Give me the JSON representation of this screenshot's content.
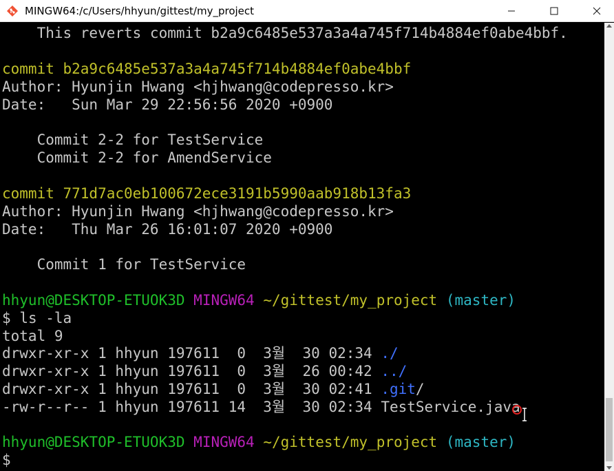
{
  "window": {
    "title": "MINGW64:/c/Users/hhyun/gittest/my_project",
    "minimize_label": "—",
    "maximize_label": "☐",
    "close_label": "✕",
    "app_icon": "git-bash-icon"
  },
  "colors": {
    "commit_hash": "#c1c12a",
    "prompt_user": "#1fbf2a",
    "prompt_shell": "#b820b8",
    "prompt_path": "#c1c12a",
    "prompt_branch": "#2eb7c4",
    "directory": "#4070ff",
    "text": "#c8c8c8",
    "background": "#000000"
  },
  "log": {
    "revert_message": "    This reverts commit b2a9c6485e537a3a4a745f714b4884ef0abe4bbf.",
    "commits": [
      {
        "commit_line": "commit b2a9c6485e537a3a4a745f714b4884ef0abe4bbf",
        "author_line": "Author: Hyunjin Hwang <hjhwang@codepresso.kr>",
        "date_line": "Date:   Sun Mar 29 22:56:56 2020 +0900",
        "messages": [
          "    Commit 2-2 for TestService",
          "    Commit 2-2 for AmendService"
        ]
      },
      {
        "commit_line": "commit 771d7ac0eb100672ece3191b5990aab918b13fa3",
        "author_line": "Author: Hyunjin Hwang <hjhwang@codepresso.kr>",
        "date_line": "Date:   Thu Mar 26 16:01:07 2020 +0900",
        "messages": [
          "    Commit 1 for TestService"
        ]
      }
    ]
  },
  "prompt": {
    "user_host": "hhyun@DESKTOP-ETUOK3D",
    "shell": "MINGW64",
    "path": "~/gittest/my_project",
    "branch": "(master)",
    "symbol": "$"
  },
  "ls": {
    "command": "ls -la",
    "total": "total 9",
    "entries": [
      {
        "meta": "drwxr-xr-x 1 hhyun 197611  0  3월  30 02:34 ",
        "name": "./",
        "is_dir": true
      },
      {
        "meta": "drwxr-xr-x 1 hhyun 197611  0  3월  26 00:42 ",
        "name": "../",
        "is_dir": true
      },
      {
        "meta": "drwxr-xr-x 1 hhyun 197611  0  3월  30 02:41 ",
        "name": ".git",
        "suffix": "/",
        "is_dir": true
      },
      {
        "meta": "-rw-r--r-- 1 hhyun 197611 14  3월  30 02:34 ",
        "name": "TestService.java",
        "is_dir": false
      }
    ]
  },
  "scrollbar": {
    "up_arrow": "▲",
    "down_arrow": "▼"
  }
}
